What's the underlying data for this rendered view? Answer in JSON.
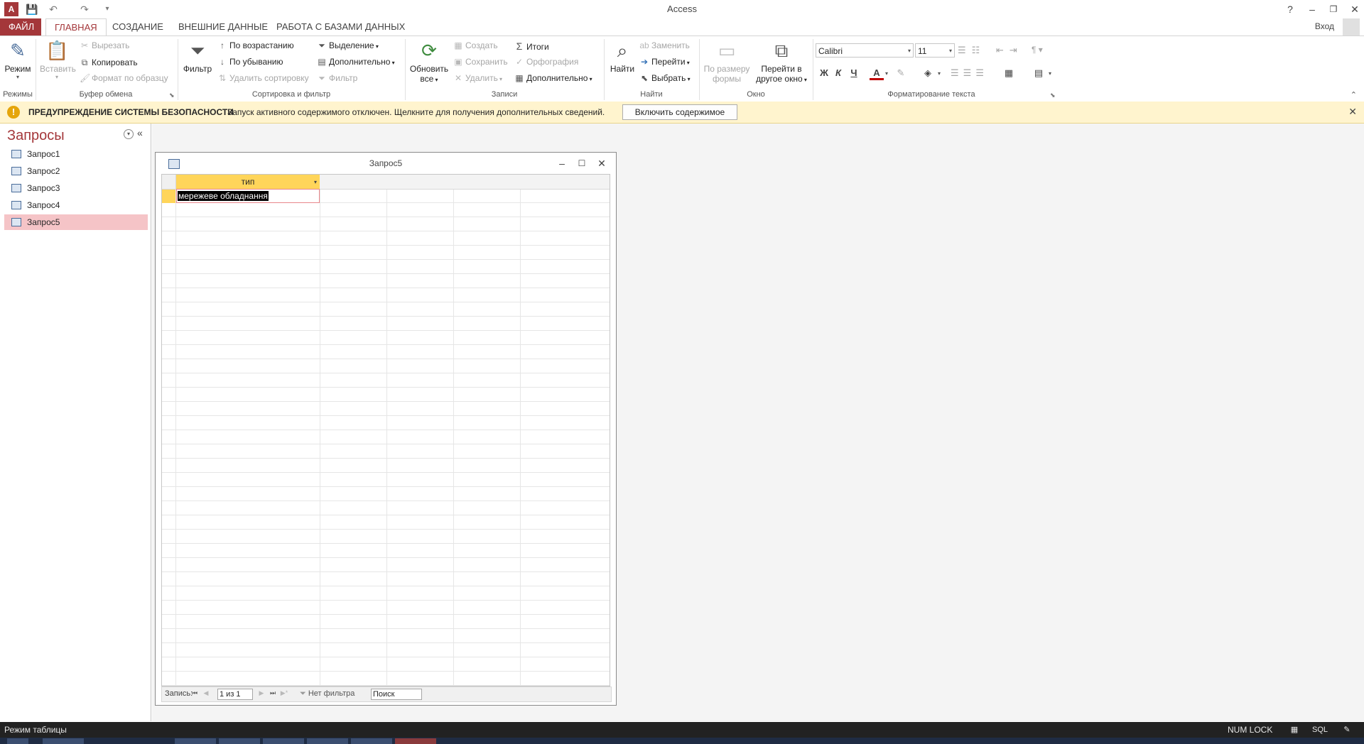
{
  "window": {
    "title": "Access",
    "help": "?",
    "minimize": "–",
    "restore": "❐",
    "close": "✕"
  },
  "qat": {
    "logo": "A",
    "save": "💾",
    "undo": "↶",
    "redo": "↷",
    "customize": "▾"
  },
  "tabs": {
    "file": "ФАЙЛ",
    "items": [
      "ГЛАВНАЯ",
      "СОЗДАНИЕ",
      "ВНЕШНИЕ ДАННЫЕ",
      "РАБОТА С БАЗАМИ ДАННЫХ"
    ],
    "signin": "Вход"
  },
  "ribbon": {
    "groups": {
      "views": "Режимы",
      "clipboard": "Буфер обмена",
      "sort_filter": "Сортировка и фильтр",
      "records": "Записи",
      "find": "Найти",
      "window": "Окно",
      "text_format": "Форматирование текста"
    },
    "view_btn": "Режим",
    "paste_btn": "Вставить",
    "cut": "Вырезать",
    "copy": "Копировать",
    "format_painter": "Формат по образцу",
    "filter_btn": "Фильтр",
    "ascending": "По возрастанию",
    "descending": "По убыванию",
    "remove_sort": "Удалить сортировку",
    "selection": "Выделение",
    "advanced": "Дополнительно",
    "toggle_filter": "Фильтр",
    "refresh_line1": "Обновить",
    "refresh_line2": "все",
    "new": "Создать",
    "save": "Сохранить",
    "delete": "Удалить",
    "totals": "Итоги",
    "spelling": "Орфография",
    "more": "Дополнительно",
    "find_btn": "Найти",
    "replace": "Заменить",
    "goto": "Перейти",
    "select": "Выбрать",
    "size_form_line1": "По размеру",
    "size_form_line2": "формы",
    "switch_windows_line1": "Перейти в",
    "switch_windows_line2": "другое окно",
    "font_name": "Calibri",
    "font_size": "11",
    "bold": "Ж",
    "italic": "К",
    "underline": "Ч",
    "font_color_glyph": "A"
  },
  "security": {
    "title": "ПРЕДУПРЕЖДЕНИЕ СИСТЕМЫ БЕЗОПАСНОСТИ",
    "message": "Запуск активного содержимого отключен. Щелкните для получения дополнительных сведений.",
    "button": "Включить содержимое",
    "icon": "!"
  },
  "nav": {
    "title": "Запросы",
    "items": [
      "Запрос1",
      "Запрос2",
      "Запрос3",
      "Запрос4",
      "Запрос5"
    ],
    "selected_index": 4
  },
  "query_window": {
    "title": "Запрос5",
    "column": "тип",
    "cell_value": "мережеве обладнання",
    "record_label": "Запись:",
    "record_pos": "1 из 1",
    "filter_status": "Нет фильтра",
    "search_placeholder": "Поиск"
  },
  "status": {
    "mode": "Режим таблицы",
    "numlock": "NUM LOCK",
    "sql": "SQL"
  },
  "colors": {
    "accent": "#a4373a",
    "warning_bar": "#fff4ce",
    "header_highlight": "#ffd55a",
    "nav_selected": "#f5c4c7"
  }
}
